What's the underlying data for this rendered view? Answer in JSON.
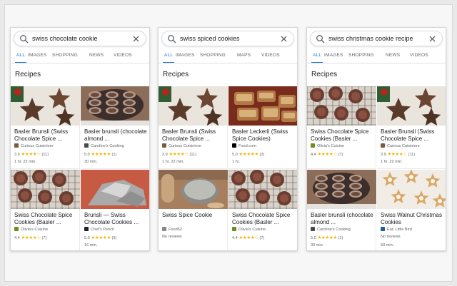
{
  "phones": [
    {
      "query": "swiss chocolate cookie",
      "tabs": [
        "ALL",
        "IMAGES",
        "SHOPPING",
        "NEWS",
        "VIDEOS"
      ],
      "section_title": "Recipes",
      "cards": [
        {
          "title": "Basler Brunsli (Swiss Chocolate Spice ...",
          "source": "Curious Cuisiniere",
          "rating": "3.9",
          "stars": "★★★★☆",
          "reviews": "(11)",
          "time": "1 hr. 22 min.",
          "image": "brunsli-star-cookies"
        },
        {
          "title": "Basler brunsli (chocolate almond ...",
          "source": "Caroline's Cooking",
          "rating": "5.0",
          "stars": "★★★★★",
          "reviews": "(1)",
          "time": "30 min.",
          "image": "brunsli-plate"
        },
        {
          "title": "Swiss Chocolate Spice Cookies (Basler ...",
          "source": "Olivia's Cuisine",
          "rating": "4.4",
          "stars": "★★★★☆",
          "reviews": "(7)",
          "time": "",
          "image": "brunsli-cooling-rack"
        },
        {
          "title": "Brunsli — Swiss Chocolate Cookies ...",
          "source": "Chef's Pencil",
          "rating": "5.0",
          "stars": "★★★★★",
          "reviews": "(5)",
          "time": "16 min.",
          "image": "cookies-foil"
        }
      ]
    },
    {
      "query": "swiss spiced cookies",
      "tabs": [
        "ALL",
        "IMAGES",
        "SHOPPING",
        "MAPS",
        "VIDEOS"
      ],
      "section_title": "Recipes",
      "cards": [
        {
          "title": "Basler Brunsli (Swiss Chocolate Spice ...",
          "source": "Curious Cuisiniere",
          "rating": "3.9",
          "stars": "★★★★☆",
          "reviews": "(11)",
          "time": "1 hr. 22 min.",
          "image": "brunsli-star-cookies"
        },
        {
          "title": "Basler Leckerli (Swiss Spice Cookies)",
          "source": "Food.com",
          "rating": "5.0",
          "stars": "★★★★★",
          "reviews": "(2)",
          "time": "1 hr.",
          "image": "leckerli-pieces"
        },
        {
          "title": "Swiss Spice Cookie",
          "source": "Food52",
          "rating": "",
          "stars": "",
          "reviews": "",
          "noreviews": "No reviews",
          "time": "",
          "image": "cookie-tin"
        },
        {
          "title": "Swiss Chocolate Spice Cookies (Basler ...",
          "source": "Olivia's Cuisine",
          "rating": "4.4",
          "stars": "★★★★☆",
          "reviews": "(7)",
          "time": "",
          "image": "brunsli-cooling-rack"
        }
      ]
    },
    {
      "query": "swiss christmas cookie recipe",
      "tabs": [
        "ALL",
        "IMAGES",
        "SHOPPING",
        "NEWS",
        "VIDEOS"
      ],
      "section_title": "Recipes",
      "cards": [
        {
          "title": "Swiss Chocolate Spice Cookies (Basler ...",
          "source": "Olivia's Cuisine",
          "rating": "4.4",
          "stars": "★★★★☆",
          "reviews": "(7)",
          "time": "",
          "image": "brunsli-cooling-rack"
        },
        {
          "title": "Basler Brunsli (Swiss Chocolate Spice ...",
          "source": "Curious Cuisiniere",
          "rating": "3.9",
          "stars": "★★★★☆",
          "reviews": "(11)",
          "time": "1 hr. 22 min.",
          "image": "brunsli-star-cookies"
        },
        {
          "title": "Basler brunsli (chocolate almond ...",
          "source": "Caroline's Cooking",
          "rating": "5.0",
          "stars": "★★★★★",
          "reviews": "(1)",
          "time": "30 min.",
          "image": "brunsli-plate"
        },
        {
          "title": "Swiss Walnut Christmas Cookies",
          "source": "Eat, Little Bird",
          "rating": "",
          "stars": "",
          "reviews": "",
          "noreviews": "No reviews",
          "time": "50 min.",
          "image": "walnut-star-cookies"
        }
      ]
    }
  ]
}
